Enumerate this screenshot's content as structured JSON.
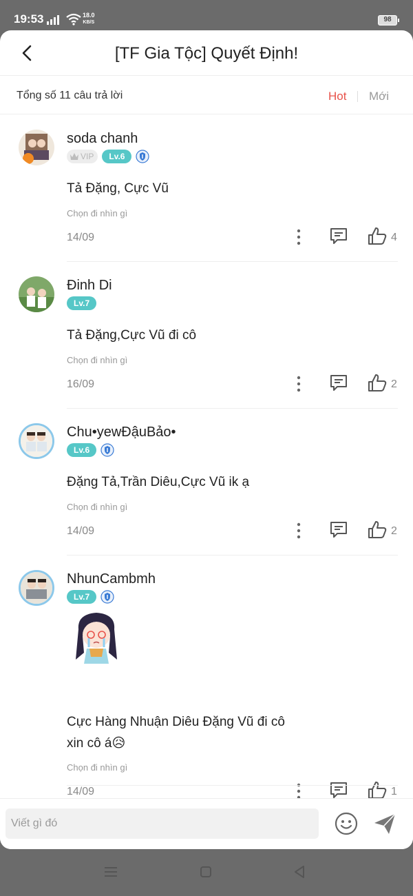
{
  "status_bar": {
    "time": "19:53",
    "net_speed_value": "18.0",
    "net_speed_unit": "KB/S",
    "battery": "98"
  },
  "header": {
    "title": "[TF Gia Tộc] Quyết Định!"
  },
  "sort": {
    "total": "Tổng số 11 câu trả lời",
    "hot": "Hot",
    "new": "Mới",
    "active": "Hot"
  },
  "colors": {
    "accent": "#e8524a",
    "level_badge": "#56c7c7"
  },
  "comments": [
    {
      "user": "soda chanh",
      "vip": "VIP",
      "level": "Lv.6",
      "text": "Tả Đặng, Cực Vũ",
      "choose": "Chọn đi nhìn gì",
      "date": "14/09",
      "likes": "4"
    },
    {
      "user": "Đinh Di",
      "level": "Lv.7",
      "text": "Tả Đặng,Cực Vũ đi cô",
      "choose": "Chọn đi nhìn gì",
      "date": "16/09",
      "likes": "2"
    },
    {
      "user": "Chu•yewĐậuBảo•",
      "level": "Lv.6",
      "text": "Đặng Tả,Trần Diêu,Cực Vũ ik ạ",
      "choose": "Chọn đi nhìn gì",
      "date": "14/09",
      "likes": "2"
    },
    {
      "user": "NhunCambmh",
      "level": "Lv.7",
      "text_line1": "Cực Hàng Nhuận Diêu Đặng Vũ đi cô",
      "text_line2": "xin cô á😥",
      "choose": "Chọn đi nhìn gì",
      "date": "14/09",
      "likes": "1"
    }
  ],
  "composer": {
    "placeholder": "Viết gì đó"
  },
  "icons": [
    "back-arrow-icon",
    "more-vertical-icon",
    "comment-icon",
    "thumbs-up-icon",
    "smiley-icon",
    "send-icon",
    "shield-icon",
    "crown-icon"
  ]
}
